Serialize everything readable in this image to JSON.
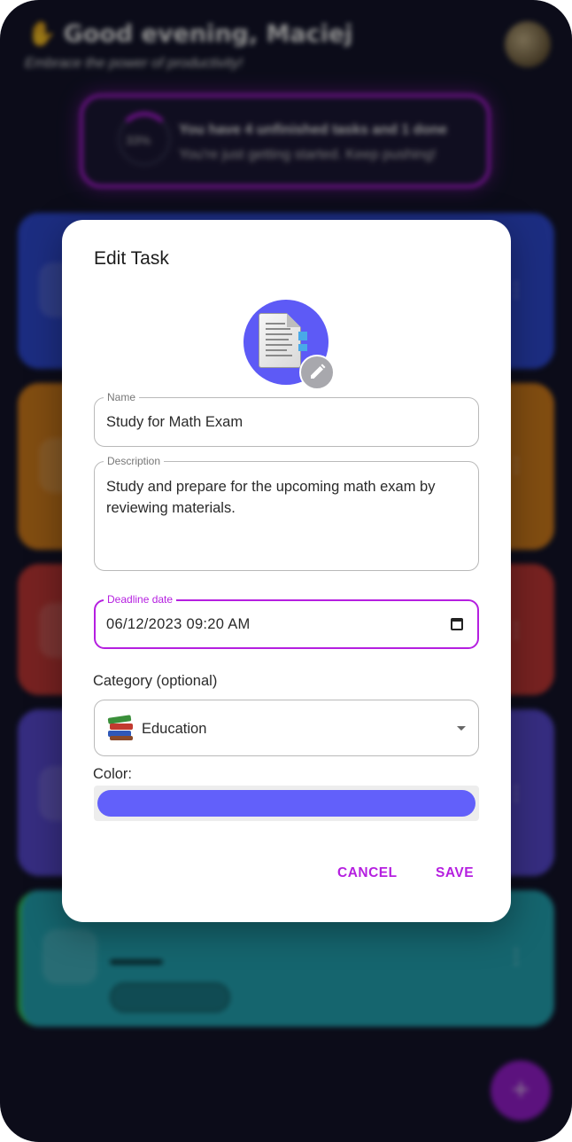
{
  "background": {
    "greeting": "Good evening, Maciej",
    "subtitle": "Embrace the power of productivity!",
    "progress": {
      "percent": "33%",
      "title": "You have 4 unfinished tasks and 1 done",
      "subtitle": "You're just getting started. Keep pushing!"
    },
    "fab_label": "+"
  },
  "dialog": {
    "title": "Edit Task",
    "name": {
      "label": "Name",
      "value": "Study for Math Exam"
    },
    "description": {
      "label": "Description",
      "value": "Study and prepare for the upcoming math exam by reviewing materials."
    },
    "deadline": {
      "label": "Deadline date",
      "value": "06/12/2023 09:20 AM"
    },
    "category": {
      "label": "Category (optional)",
      "selected": "Education",
      "icon": "books-emoji"
    },
    "color": {
      "label": "Color:",
      "value": "#6260fa"
    },
    "actions": {
      "cancel": "CANCEL",
      "save": "SAVE"
    }
  },
  "colors": {
    "accent": "#b51fe0",
    "task_avatar": "#5d5af6"
  }
}
